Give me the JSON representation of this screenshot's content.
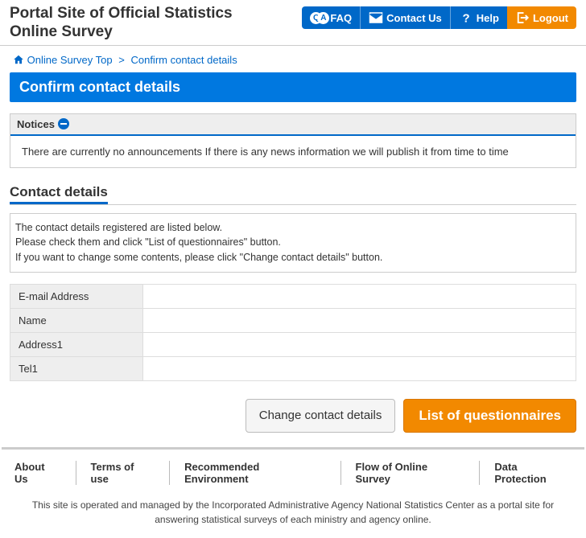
{
  "header": {
    "site_title_line1": "Portal Site of Official Statistics",
    "site_title_line2": "Online Survey",
    "nav": {
      "faq": "FAQ",
      "contact": "Contact Us",
      "help": "Help",
      "logout": "Logout"
    }
  },
  "breadcrumb": {
    "home": "Online Survey Top",
    "current": "Confirm contact details"
  },
  "page_title": "Confirm contact details",
  "notices": {
    "heading": "Notices",
    "body": "There are currently no announcements If there is any news information we will publish it from time to time"
  },
  "contact": {
    "heading": "Contact details",
    "info_line1": "The contact details registered are listed below.",
    "info_line2": "Please check them and click \"List of questionnaires\" button.",
    "info_line3": "If you want to change some contents, please click \"Change contact details\" button.",
    "rows": [
      {
        "label": "E-mail Address",
        "value": ""
      },
      {
        "label": "Name",
        "value": ""
      },
      {
        "label": "Address1",
        "value": ""
      },
      {
        "label": "Tel1",
        "value": ""
      }
    ]
  },
  "buttons": {
    "change": "Change contact details",
    "list": "List of questionnaires"
  },
  "footer": {
    "links": [
      "About Us",
      "Terms of use",
      "Recommended Environment",
      "Flow of Online Survey",
      "Data Protection"
    ],
    "note": "This site is operated and managed by the Incorporated Administrative Agency National Statistics Center as a portal site for answering statistical surveys of each ministry and agency online."
  }
}
